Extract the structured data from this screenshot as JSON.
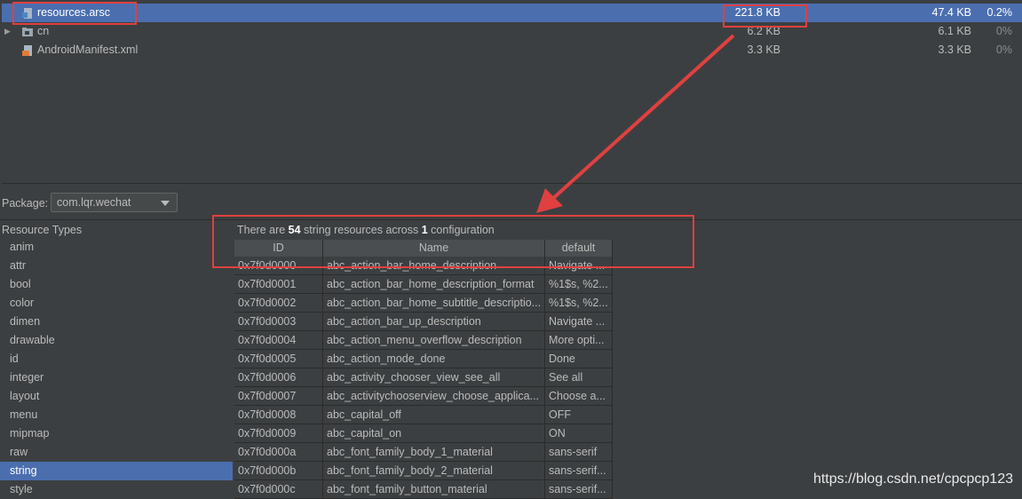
{
  "tree": {
    "rows": [
      {
        "name": "resources.arsc",
        "raw_size": "221.8 KB",
        "download_size": "47.4 KB",
        "percent": "0.2%",
        "icon": "arsc-file-icon",
        "expandable": false,
        "selected": true
      },
      {
        "name": "cn",
        "raw_size": "6.2 KB",
        "download_size": "6.1 KB",
        "percent": "0%",
        "icon": "folder-icon",
        "expandable": true,
        "selected": false
      },
      {
        "name": "AndroidManifest.xml",
        "raw_size": "3.3 KB",
        "download_size": "3.3 KB",
        "percent": "0%",
        "icon": "xml-file-icon",
        "expandable": false,
        "selected": false
      }
    ]
  },
  "package": {
    "label": "Package:",
    "value": "com.lqr.wechat"
  },
  "resource_types": {
    "header": "Resource Types",
    "items": [
      "anim",
      "attr",
      "bool",
      "color",
      "dimen",
      "drawable",
      "id",
      "integer",
      "layout",
      "menu",
      "mipmap",
      "raw",
      "string",
      "style"
    ],
    "selected": "string"
  },
  "summary": {
    "prefix": "There are ",
    "count": "54",
    "middle": " string resources across ",
    "config_count": "1",
    "suffix": " configuration"
  },
  "table": {
    "headers": {
      "id": "ID",
      "name": "Name",
      "default": "default"
    },
    "rows": [
      {
        "id": "0x7f0d0000",
        "name": "abc_action_bar_home_description",
        "default": "Navigate ..."
      },
      {
        "id": "0x7f0d0001",
        "name": "abc_action_bar_home_description_format",
        "default": "%1$s, %2..."
      },
      {
        "id": "0x7f0d0002",
        "name": "abc_action_bar_home_subtitle_descriptio...",
        "default": "%1$s, %2..."
      },
      {
        "id": "0x7f0d0003",
        "name": "abc_action_bar_up_description",
        "default": "Navigate ..."
      },
      {
        "id": "0x7f0d0004",
        "name": "abc_action_menu_overflow_description",
        "default": "More opti..."
      },
      {
        "id": "0x7f0d0005",
        "name": "abc_action_mode_done",
        "default": "Done"
      },
      {
        "id": "0x7f0d0006",
        "name": "abc_activity_chooser_view_see_all",
        "default": "See all"
      },
      {
        "id": "0x7f0d0007",
        "name": "abc_activitychooserview_choose_applica...",
        "default": "Choose a..."
      },
      {
        "id": "0x7f0d0008",
        "name": "abc_capital_off",
        "default": "OFF"
      },
      {
        "id": "0x7f0d0009",
        "name": "abc_capital_on",
        "default": "ON"
      },
      {
        "id": "0x7f0d000a",
        "name": "abc_font_family_body_1_material",
        "default": "sans-serif"
      },
      {
        "id": "0x7f0d000b",
        "name": "abc_font_family_body_2_material",
        "default": "sans-serif..."
      },
      {
        "id": "0x7f0d000c",
        "name": "abc_font_family_button_material",
        "default": "sans-serif..."
      }
    ]
  },
  "watermark": "https://blog.csdn.net/cpcpcp123",
  "colors": {
    "background": "#3c3f41",
    "selection": "#4b6eaf",
    "annotation_red": "#e04040",
    "text": "#bbbbbb"
  }
}
